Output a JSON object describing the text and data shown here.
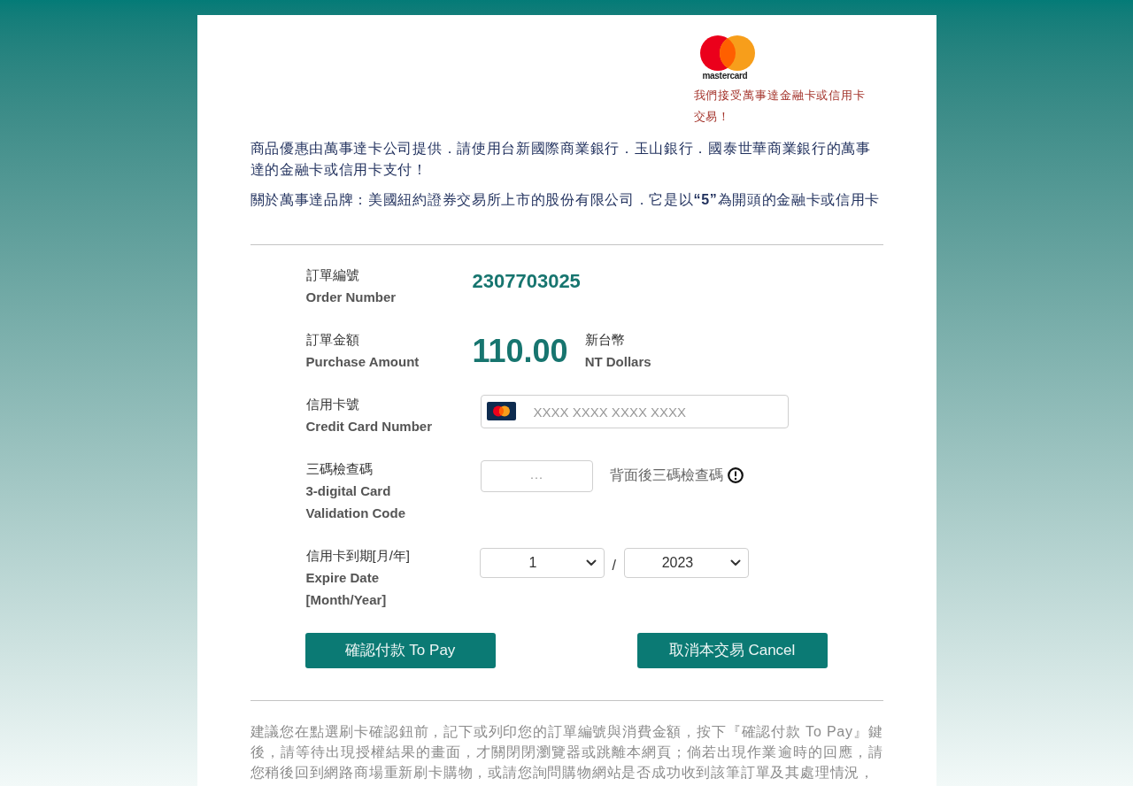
{
  "brand_logo": {
    "wordmark": "mastercard"
  },
  "accepted_note": "我們接受萬事達金融卡或信用卡交易！",
  "intro": [
    "商品優惠由萬事達卡公司提供．請使用台新國際商業銀行．玉山銀行．國泰世華商業銀行的萬事達的金融卡或信用卡支付！",
    "關於萬事達品牌：美國紐約證券交易所上市的股份有限公司．它是以**“5”**為開頭的金融卡或信用卡"
  ],
  "fields": [
    {
      "kind": "order_number",
      "label_zh": "訂單編號",
      "label_en": "Order Number",
      "value": "2307703025"
    },
    {
      "kind": "amount",
      "label_zh": "訂單金額",
      "label_en": "Purchase Amount",
      "value": "110.00",
      "currency_zh": "新台幣",
      "currency_en": "NT Dollars"
    },
    {
      "kind": "card_number",
      "label_zh": "信用卡號",
      "label_en": "Credit Card Number",
      "placeholder": "XXXX XXXX XXXX XXXX"
    },
    {
      "kind": "cvv",
      "label_zh": "三碼檢查碼",
      "label_en": "3-digital Card Validation Code",
      "placeholder": "···",
      "hint": "背面後三碼檢查碼"
    },
    {
      "kind": "expiry",
      "label_zh": "信用卡到期[月/年]",
      "label_en": "Expire Date [Month/Year]",
      "month": "1",
      "separator": "/",
      "year": "2023"
    }
  ],
  "buttons": [
    "確認付款 To Pay",
    "取消本交易 Cancel"
  ],
  "notice": "建議您在點選刷卡確認鈕前，記下或列印您的訂單編號與消費金額，按下『確認付款 To Pay』鍵後，請等待出現授權結果的畫面，才關閉閉瀏覽器或跳離本網頁；倘若出現作業逾時的回應，請您稍後回到網路商場重新刷卡購物，或請您詢問購物網站是否成功收到該筆訂單及其處理情況，"
}
